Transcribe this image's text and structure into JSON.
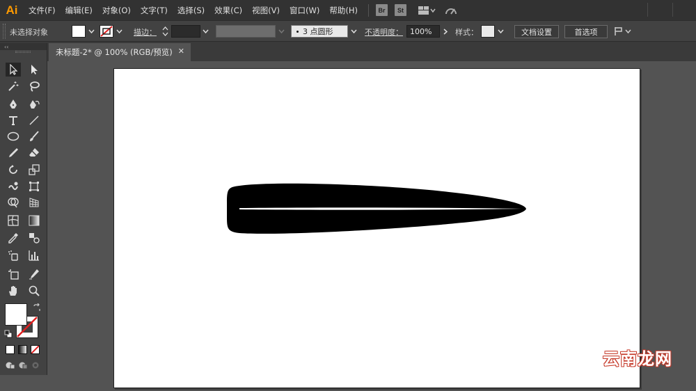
{
  "app": {
    "logo": "Ai",
    "accent": "#ff9a00"
  },
  "menu": {
    "items": [
      "文件(F)",
      "编辑(E)",
      "对象(O)",
      "文字(T)",
      "选择(S)",
      "效果(C)",
      "视图(V)",
      "窗口(W)",
      "帮助(H)"
    ],
    "bridge_label": "Br",
    "stock_label": "St"
  },
  "control_bar": {
    "selection_status": "未选择对象",
    "stroke_label": "描边：",
    "brush_value": "3 点圆形",
    "opacity_label": "不透明度：",
    "opacity_value": "100%",
    "style_label": "样式：",
    "doc_setup_button": "文档设置",
    "prefs_button": "首选项"
  },
  "document": {
    "tab_title": "未标题-2* @ 100% (RGB/预览)",
    "close_glyph": "✕"
  },
  "toolbar": {
    "collapse_glyph": "‹‹",
    "tools": [
      "selection",
      "direct-selection",
      "magic-wand",
      "lasso",
      "pen",
      "curvature",
      "type",
      "line-segment",
      "ellipse",
      "paintbrush",
      "pencil",
      "eraser",
      "rotate",
      "scale",
      "warp",
      "free-transform",
      "shape-builder",
      "perspective-grid",
      "mesh",
      "gradient",
      "eyedropper",
      "blend",
      "symbol-sprayer",
      "column-graph",
      "artboard",
      "slice",
      "hand",
      "zoom"
    ]
  },
  "watermark": {
    "text": "云南龙网",
    "color": "#c63b2b"
  }
}
